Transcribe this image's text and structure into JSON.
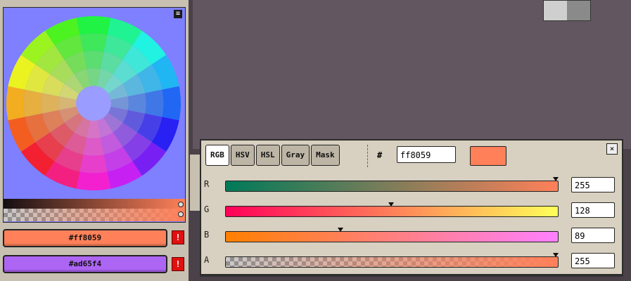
{
  "palette": {
    "foreground_hex": "#ff8059",
    "background_hex": "#ad65f4",
    "warn_label": "!"
  },
  "color_editor": {
    "tabs": [
      {
        "label": "RGB",
        "active": true
      },
      {
        "label": "HSV",
        "active": false
      },
      {
        "label": "HSL",
        "active": false
      },
      {
        "label": "Gray",
        "active": false
      },
      {
        "label": "Mask",
        "active": false
      }
    ],
    "hash_label": "#",
    "hex_value": "ff8059",
    "close_label": "×",
    "channels": [
      {
        "label": "R",
        "value": "255",
        "fraction": 1.0,
        "gradient": "linear-gradient(90deg,#007a59,#ff8059)"
      },
      {
        "label": "G",
        "value": "128",
        "fraction": 0.502,
        "gradient": "linear-gradient(90deg,#ff0059,#ffff59)"
      },
      {
        "label": "B",
        "value": "89",
        "fraction": 0.349,
        "gradient": "linear-gradient(90deg,#ff8000,#ff80ff)"
      },
      {
        "label": "A",
        "value": "255",
        "fraction": 1.0,
        "gradient": "linear-gradient(90deg,rgba(255,128,89,0),#ff8059),repeating-conic-gradient(#8f8f8f 0 25%,#c9c9c9 0 50%) 0 0/12px 12px"
      }
    ]
  },
  "colors": {
    "accent": "#ff8059",
    "secondary": "#ad65f4",
    "wheel_bg": "#7e80ff",
    "canvas": "#625760"
  },
  "icons": {
    "menu": "hamburger-icon",
    "close": "close-icon",
    "warn": "warning-icon"
  }
}
